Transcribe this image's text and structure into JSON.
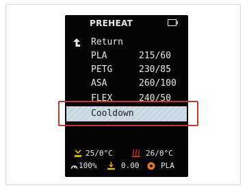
{
  "screen": {
    "title": "PREHEAT",
    "icons": {
      "sd_card": "sd-card-icon",
      "return": "return-arrow-icon"
    },
    "menu": [
      {
        "label": "Return",
        "value": ""
      },
      {
        "label": "PLA",
        "value": "215/60"
      },
      {
        "label": "PETG",
        "value": "230/85"
      },
      {
        "label": "ASA",
        "value": "260/100"
      },
      {
        "label": "FLEX",
        "value": "240/50"
      },
      {
        "label": "Cooldown",
        "value": ""
      }
    ],
    "selected_item": "Cooldown",
    "status": {
      "bed_temp": "25/0°C",
      "hotend_temp": "26/0°C",
      "fan": "100%",
      "z_offset": "0.00",
      "material": "PLA"
    }
  },
  "colors": {
    "screen_bg": "#050505",
    "text": "#e8e8e8",
    "selection_bg": "#c5d6e1",
    "highlight_border": "#c0392b",
    "bed_icon": "#e0b000",
    "hotend_icon": "#d0311f",
    "z_icon": "#e0b000",
    "material_icon": "#e07a30"
  }
}
